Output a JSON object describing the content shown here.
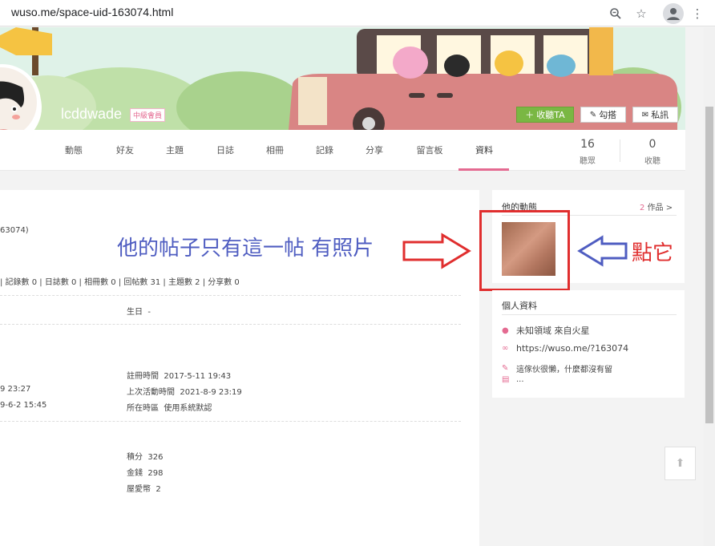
{
  "browser": {
    "url": "wuso.me/space-uid-163074.html",
    "icons": [
      "zoom-icon",
      "star-icon",
      "profile-icon",
      "menu-icon"
    ]
  },
  "header": {
    "username": "lcddwade",
    "badge": "中級會員",
    "follow_btn": "收聽TA",
    "greet_btn": "勾搭",
    "message_btn": "私訊",
    "tabs": [
      "動態",
      "好友",
      "主題",
      "日誌",
      "相冊",
      "記錄",
      "分享",
      "留言板",
      "資料"
    ],
    "active_tab": "資料",
    "stats": [
      {
        "num": "16",
        "label": "聽眾"
      },
      {
        "num": "0",
        "label": "收聽"
      }
    ]
  },
  "main": {
    "uid_frag": "63074)",
    "counts": "| 記錄數 0 | 日誌數 0 | 相冊數 0 | 回帖數 31 | 主題數 2 | 分享數 0",
    "birthday_label": "生日",
    "birthday_value": "-",
    "left_time1": "9 23:27",
    "left_time2": "9-6-2 15:45",
    "reg_label": "註冊時間",
    "reg_value": "2017-5-11 19:43",
    "last_label": "上次活動時間",
    "last_value": "2021-8-9 23:19",
    "tz_label": "所在時區",
    "tz_value": "使用系統默認",
    "points_label": "積分",
    "points_value": "326",
    "money_label": "金錢",
    "money_value": "298",
    "love_label": "屋愛幣",
    "love_value": "2"
  },
  "sidebar": {
    "dyn_title": "他的動態",
    "works_count": "2",
    "works_label": "作品 >",
    "profile_title": "個人資料",
    "location": "未知領域 來自火星",
    "link": "https://wuso.me/?163074",
    "bio": "這傢伙很懶，什麼都沒有留",
    "more": "..."
  },
  "annotations": {
    "text_left": "他的帖子只有這一帖 有照片",
    "text_right": "點它"
  },
  "colors": {
    "accent": "#e46a91",
    "green": "#7ab743",
    "annotation_red": "#e02e2e",
    "annotation_blue": "#4f5dc1"
  }
}
